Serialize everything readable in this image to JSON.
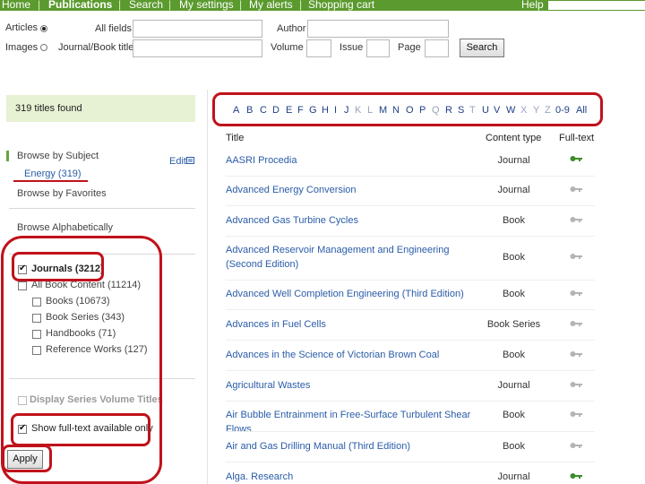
{
  "nav": {
    "home": "Home",
    "publications": "Publications",
    "search": "Search",
    "settings": "My settings",
    "alerts": "My alerts",
    "cart": "Shopping cart",
    "help": "Help"
  },
  "search": {
    "articles_label": "Articles",
    "images_label": "Images",
    "all_fields_label": "All fields",
    "author_label": "Author",
    "journal_label": "Journal/Book title",
    "volume_label": "Volume",
    "issue_label": "Issue",
    "page_label": "Page",
    "search_button": "Search"
  },
  "results": {
    "count_text": "319 titles found"
  },
  "sidebar": {
    "browse_subject": "Browse by Subject",
    "edit_label": "Edit",
    "energy_link": "Energy (319)",
    "browse_favorites": "Browse by Favorites",
    "browse_alpha": "Browse Alphabetically",
    "journals": "Journals (3212)",
    "all_books": "All Book Content (11214)",
    "books": "Books (10673)",
    "book_series": "Book Series (343)",
    "handbooks": "Handbooks (71)",
    "reference_works": "Reference Works (127)",
    "display_series": "Display Series Volume Titles",
    "show_fulltext": "Show full-text available only",
    "apply_button": "Apply"
  },
  "alphabet": {
    "A": "A",
    "B": "B",
    "C": "C",
    "D": "D",
    "E": "E",
    "F": "F",
    "G": "G",
    "H": "H",
    "I": "I",
    "J": "J",
    "K": "K",
    "L": "L",
    "M": "M",
    "N": "N",
    "O": "O",
    "P": "P",
    "Q": "Q",
    "R": "R",
    "S": "S",
    "T": "T",
    "U": "U",
    "V": "V",
    "W": "W",
    "X": "X",
    "Y": "Y",
    "Z": "Z",
    "num": "0-9",
    "all": "All"
  },
  "table": {
    "col_title": "Title",
    "col_type": "Content type",
    "col_fulltext": "Full-text",
    "rows": [
      {
        "title": "AASRI Procedia",
        "type": "Journal"
      },
      {
        "title": "Advanced Energy Conversion",
        "type": "Journal"
      },
      {
        "title": "Advanced Gas Turbine Cycles",
        "type": "Book"
      },
      {
        "title": "Advanced Reservoir Management and Engineering (Second Edition)",
        "type": "Book"
      },
      {
        "title": "Advanced Well Completion Engineering (Third Edition)",
        "type": "Book"
      },
      {
        "title": "Advances in Fuel Cells",
        "type": "Book Series"
      },
      {
        "title": "Advances in the Science of Victorian Brown Coal",
        "type": "Book"
      },
      {
        "title": "Agricultural Wastes",
        "type": "Journal"
      },
      {
        "title": "Air Bubble Entrainment in Free-Surface Turbulent Shear Flows",
        "type": "Book"
      },
      {
        "title": "Air and Gas Drilling Manual (Third Edition)",
        "type": "Book"
      },
      {
        "title": "Alga. Research",
        "type": "Journal"
      }
    ]
  },
  "colors": {
    "nav_green": "#5b9a2e",
    "link_blue": "#2a5ca8",
    "annotation_red": "#c0121b",
    "key_green": "#3d8c2a",
    "key_gray": "#b4b4b4"
  },
  "icons": {
    "fulltext_key": "key-icon",
    "edit": "edit-icon"
  }
}
